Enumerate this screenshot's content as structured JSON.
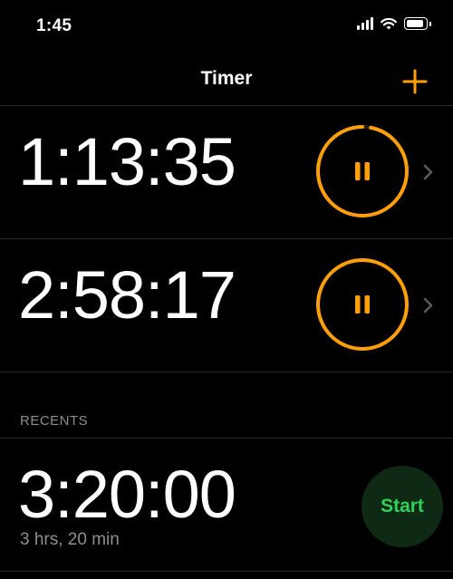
{
  "status_bar": {
    "time": "1:45",
    "icons": [
      "cellular-signal-icon",
      "wifi-icon",
      "battery-icon"
    ]
  },
  "nav": {
    "title": "Timer",
    "add_icon": "plus-icon"
  },
  "timers": [
    {
      "time": "1:13:35",
      "control_icon": "pause-icon",
      "ring_progress": 0.97
    },
    {
      "time": "2:58:17",
      "control_icon": "pause-icon",
      "ring_progress": 1.0
    }
  ],
  "recents": {
    "header": "RECENTS",
    "items": [
      {
        "time": "3:20:00",
        "label": "3 hrs, 20 min",
        "button_label": "Start"
      }
    ]
  },
  "colors": {
    "background": "#000000",
    "accent_orange": "#ff9f0a",
    "start_green": "#30d158",
    "start_bg": "#0e2a14",
    "secondary_text": "#8e8e93",
    "divider": "#2a2a2c"
  }
}
